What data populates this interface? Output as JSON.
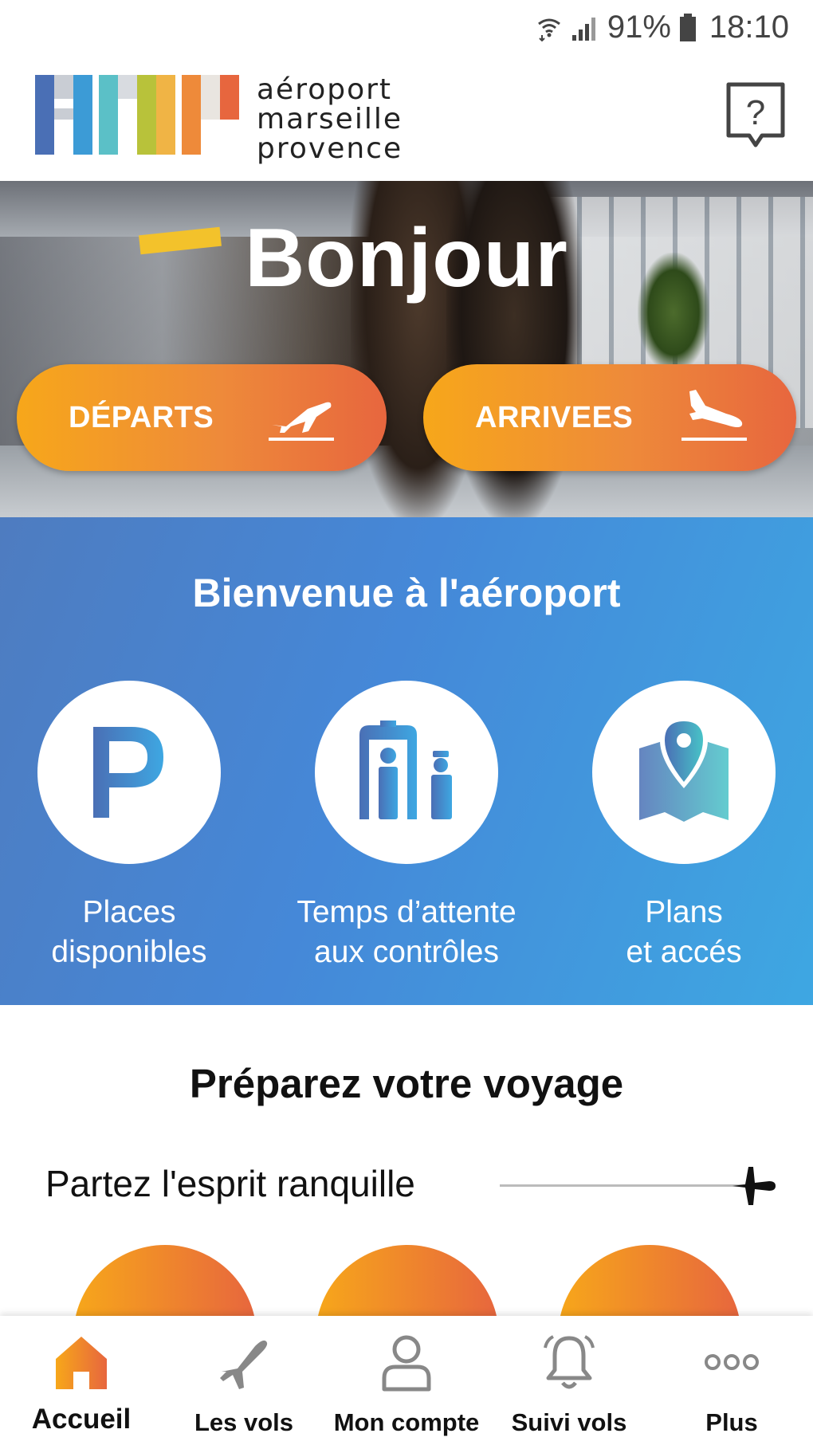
{
  "status_bar": {
    "battery": "91%",
    "time": "18:10"
  },
  "header": {
    "logo_line1": "aéroport",
    "logo_line2": "marseille",
    "logo_line3": "provence",
    "help_icon": "help-bubble-icon"
  },
  "hero": {
    "title": "Bonjour",
    "departures_label": "DÉPARTS",
    "arrivals_label": "ARRIVEES"
  },
  "welcome": {
    "title": "Bienvenue à l'aéroport",
    "services": [
      {
        "line1": "Places",
        "line2": "disponibles",
        "icon": "parking-icon"
      },
      {
        "line1": "Temps d’attente",
        "line2": "aux contrôles",
        "icon": "security-check-icon"
      },
      {
        "line1": "Plans",
        "line2": "et accés",
        "icon": "map-pin-icon"
      }
    ]
  },
  "prepare": {
    "title": "Préparez votre voyage",
    "subtitle": "Partez l'esprit ranquille"
  },
  "bottom_nav": {
    "items": [
      {
        "label": "Accueil",
        "icon": "home-icon",
        "active": true
      },
      {
        "label": "Les vols",
        "icon": "plane-icon",
        "active": false
      },
      {
        "label": "Mon compte",
        "icon": "user-icon",
        "active": false
      },
      {
        "label": "Suivi vols",
        "icon": "bell-icon",
        "active": false
      },
      {
        "label": "Plus",
        "icon": "more-icon",
        "active": false
      }
    ]
  },
  "colors": {
    "accent_orange_start": "#f7a71a",
    "accent_orange_end": "#e7663e",
    "blue_start": "#4e7cc0",
    "blue_end": "#3ea7e2",
    "nav_inactive": "#888888"
  }
}
